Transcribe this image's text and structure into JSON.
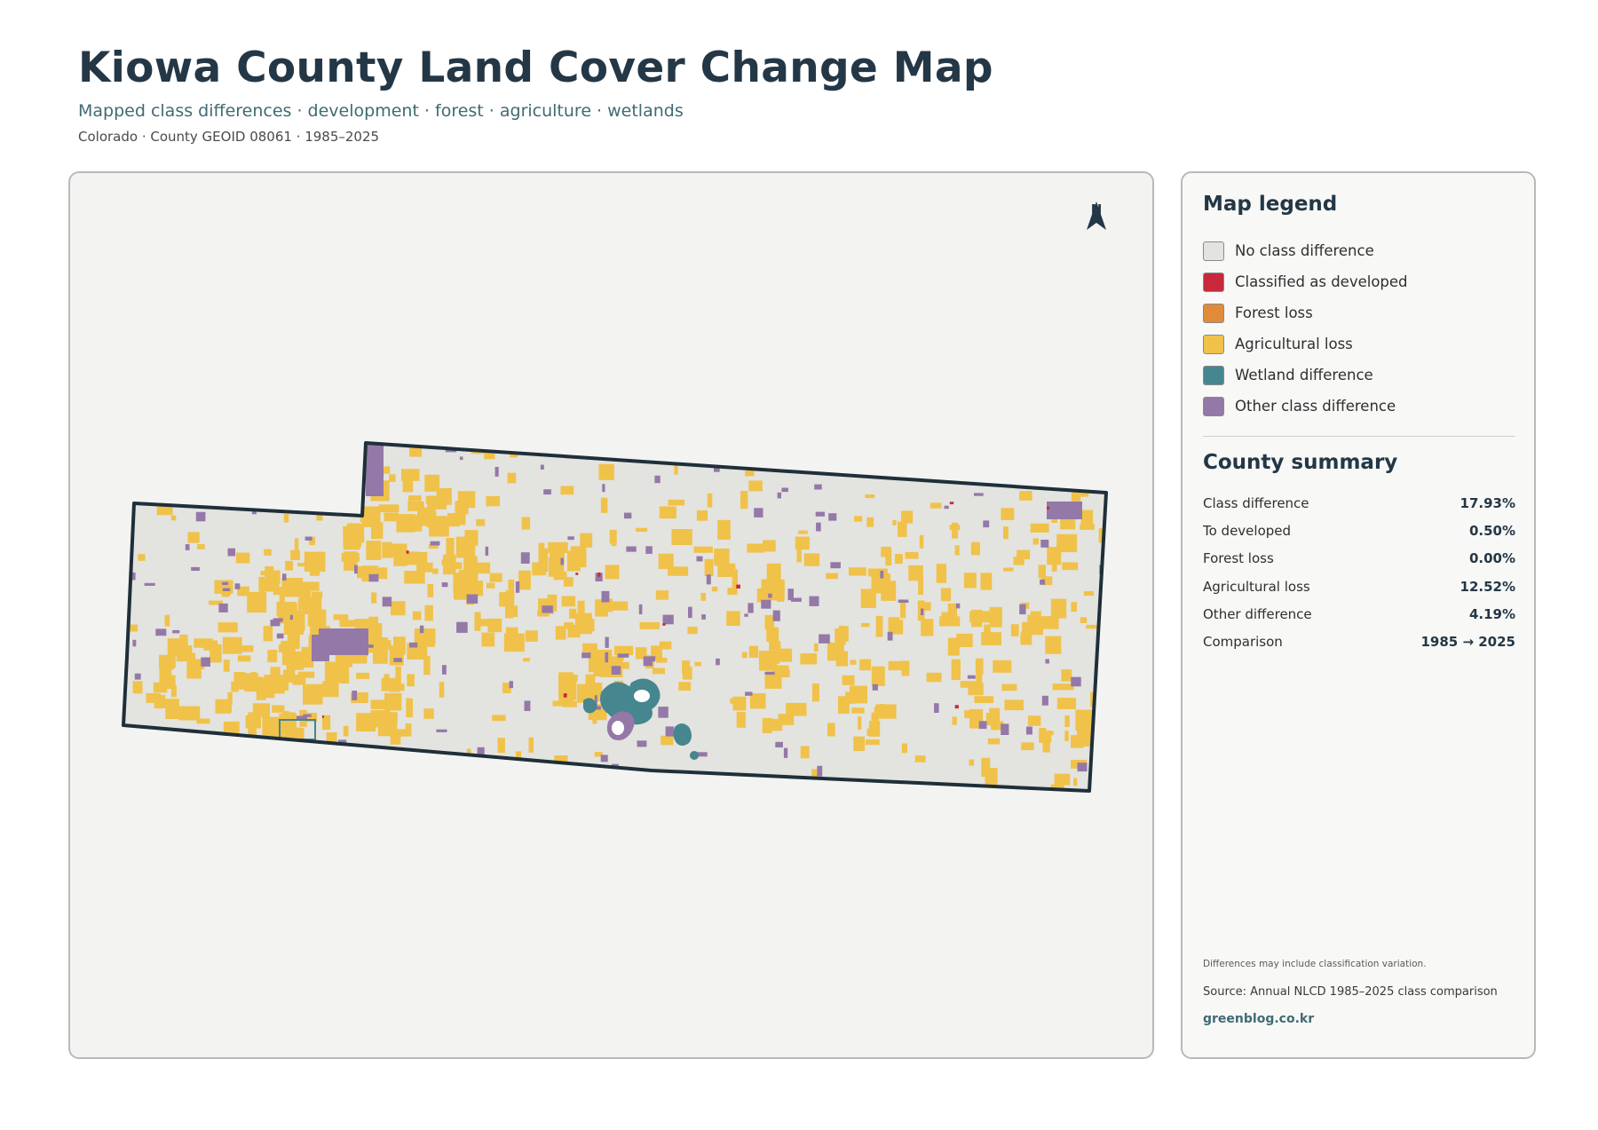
{
  "header": {
    "title": "Kiowa County Land Cover Change Map",
    "subtitle": "Mapped class differences · development · forest · agriculture · wetlands",
    "meta": "Colorado · County GEOID 08061 · 1985–2025"
  },
  "map": {
    "north_label": "N"
  },
  "legend": {
    "title": "Map legend",
    "items": [
      {
        "label": "No class difference",
        "color": "#e3e3df"
      },
      {
        "label": "Classified as developed",
        "color": "#c8283c"
      },
      {
        "label": "Forest loss",
        "color": "#e08a3c"
      },
      {
        "label": "Agricultural loss",
        "color": "#f0c24a"
      },
      {
        "label": "Wetland difference",
        "color": "#46868e"
      },
      {
        "label": "Other class difference",
        "color": "#9478a8"
      }
    ]
  },
  "summary": {
    "title": "County summary",
    "rows": [
      {
        "label": "Class difference",
        "value": "17.93%"
      },
      {
        "label": "To developed",
        "value": "0.50%"
      },
      {
        "label": "Forest loss",
        "value": "0.00%"
      },
      {
        "label": "Agricultural loss",
        "value": "12.52%"
      },
      {
        "label": "Other difference",
        "value": "4.19%"
      },
      {
        "label": "Comparison",
        "value": "1985 → 2025"
      }
    ]
  },
  "footer": {
    "note": "Differences may include classification variation.",
    "source": "Source: Annual NLCD 1985–2025 class comparison",
    "link": "greenblog.co.kr"
  }
}
